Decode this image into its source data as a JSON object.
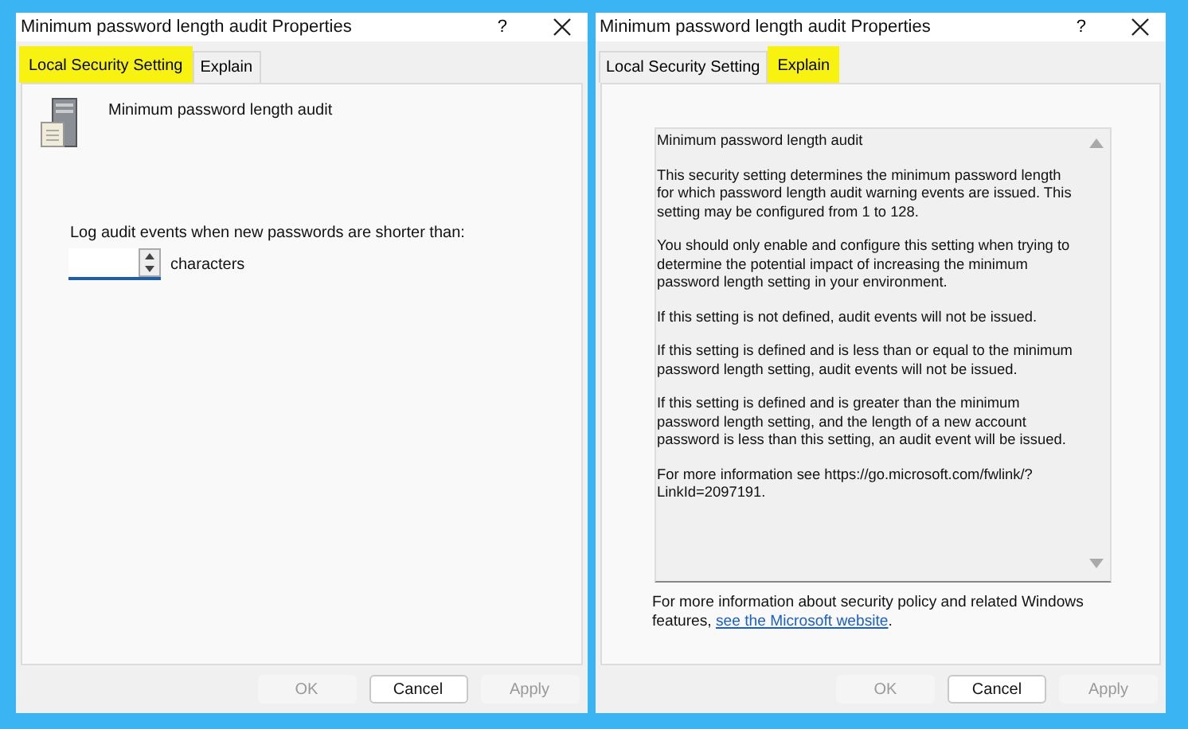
{
  "dialogs": [
    {
      "title": "Minimum password length audit Properties",
      "help": "?",
      "tabs": [
        {
          "label": "Local Security Setting",
          "selected": true
        },
        {
          "label": "Explain",
          "selected": false
        }
      ],
      "kind": "setting",
      "policy_name": "Minimum password length audit",
      "prompt": "Log audit events when new passwords are shorter than:",
      "spin": {
        "unit": "characters"
      },
      "buttons": [
        {
          "label": "OK",
          "disabled": true
        },
        {
          "label": "Cancel",
          "disabled": false
        },
        {
          "label": "Apply",
          "disabled": true
        }
      ]
    },
    {
      "title": "Minimum password length audit Properties",
      "help": "?",
      "tabs": [
        {
          "label": "Local Security Setting",
          "selected": false
        },
        {
          "label": "Explain",
          "selected": true
        }
      ],
      "kind": "explain",
      "paragraphs": [
        "Minimum password length audit",
        "This security setting determines the minimum password length for which password length audit warning events are issued. This setting may be configured from 1 to 128.",
        "You should only enable and configure this setting when trying to determine the potential impact of increasing the minimum password length setting in your environment.",
        "If this setting is not defined, audit events will not be issued.",
        "If this setting is defined and is less than or equal to the minimum password length setting, audit events will not be issued.",
        "If this setting is defined and is greater than the minimum password length setting, and the length of a new account password is less than this setting, an audit event will be issued.",
        "For more information see https://go.microsoft.com/fwlink/?LinkId=2097191."
      ],
      "footer": {
        "text": "For more information about security policy and related Windows features,",
        "link": "see the Microsoft website",
        "after": "."
      },
      "buttons": [
        {
          "label": "OK",
          "disabled": true
        },
        {
          "label": "Cancel",
          "disabled": false
        },
        {
          "label": "Apply",
          "disabled": true
        }
      ]
    }
  ]
}
